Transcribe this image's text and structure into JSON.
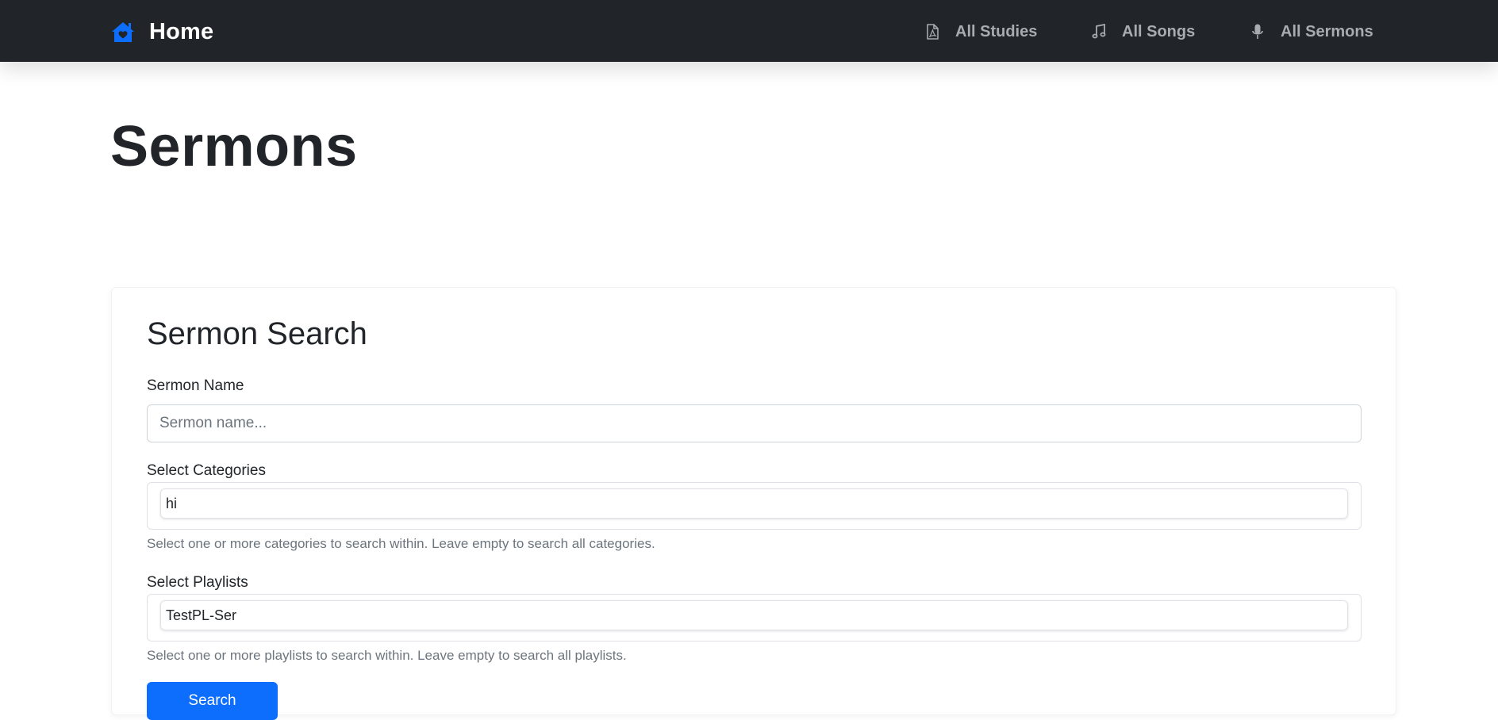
{
  "navbar": {
    "brand_label": "Home",
    "brand_icon": "home-icon",
    "items": [
      {
        "label": "All Studies",
        "icon": "pdf-file-icon"
      },
      {
        "label": "All Songs",
        "icon": "music-note-icon"
      },
      {
        "label": "All Sermons",
        "icon": "microphone-icon"
      }
    ],
    "colors": {
      "background": "#212529",
      "brand_icon": "#0d6efd",
      "item_text": "#a7acb1"
    }
  },
  "page": {
    "title": "Sermons"
  },
  "search_card": {
    "title": "Sermon Search",
    "name_field": {
      "label": "Sermon Name",
      "placeholder": "Sermon name...",
      "value": ""
    },
    "categories": {
      "label": "Select Categories",
      "selected": [
        "hi"
      ],
      "help": "Select one or more categories to search within. Leave empty to search all categories."
    },
    "playlists": {
      "label": "Select Playlists",
      "selected": [
        "TestPL-Ser"
      ],
      "help": "Select one or more playlists to search within. Leave empty to search all playlists."
    },
    "submit": {
      "label": "Search",
      "color": "#0d6efd"
    }
  }
}
